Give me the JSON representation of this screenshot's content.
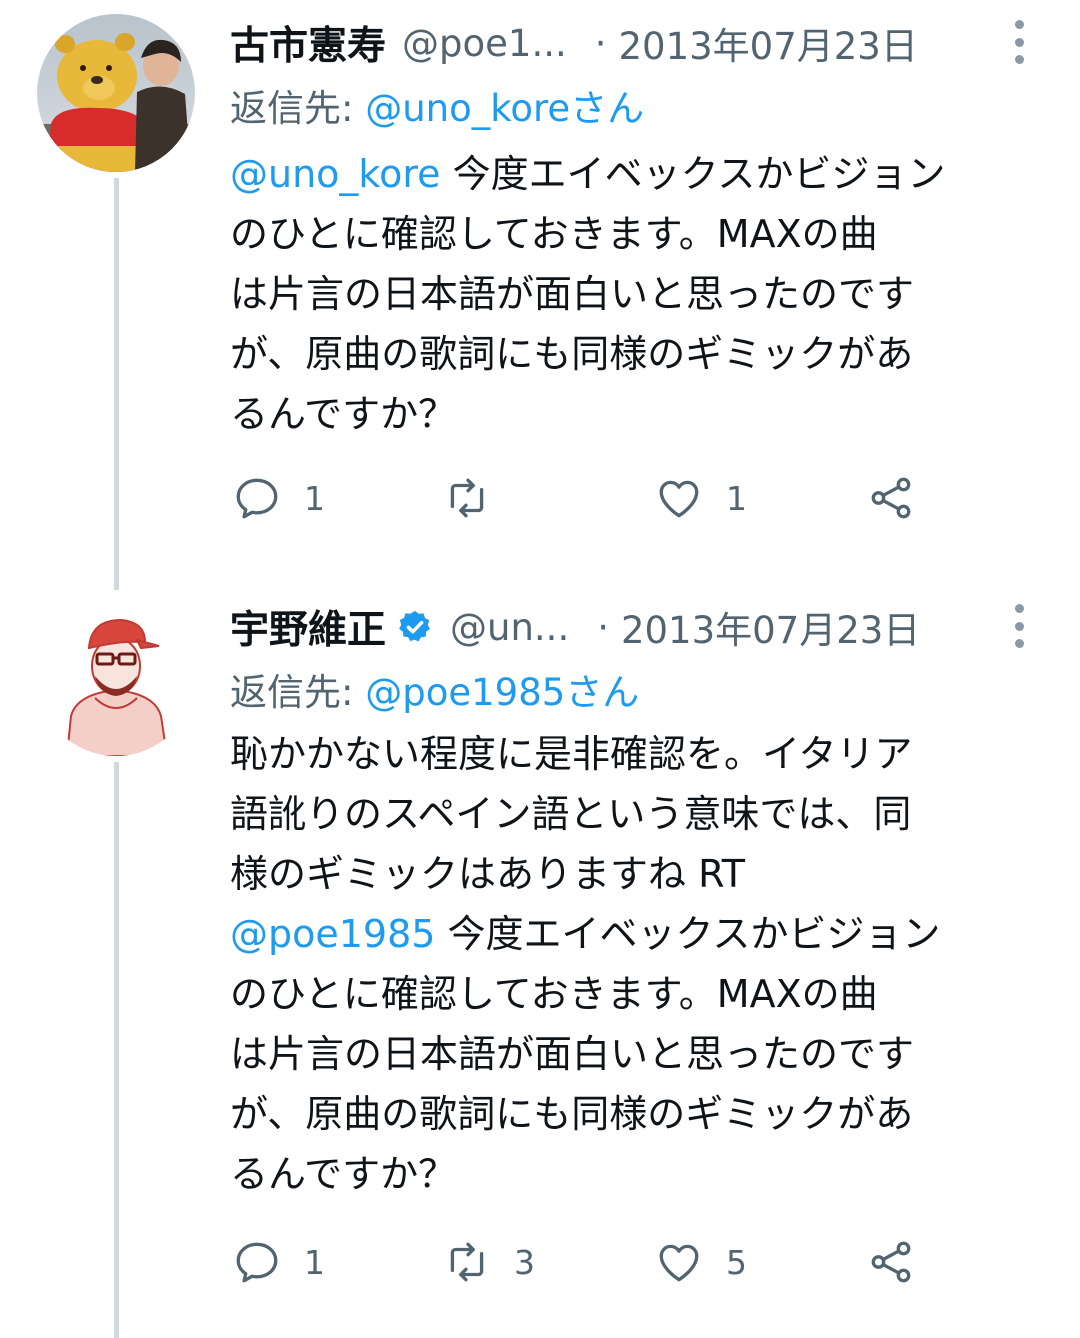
{
  "colors": {
    "accent": "#1d9bf0",
    "secondary_text": "#536471",
    "thread_line": "#cfd9de"
  },
  "tweets": [
    {
      "name": "古市憲寿",
      "handle": "@poe1...",
      "dot": "·",
      "date": "2013年07月23日",
      "reply_prefix": "返信先: ",
      "reply_to": "@uno_koreさん",
      "body": {
        "mention": "@uno_kore",
        "line1_rest": " 今度エイベックスかビジョン",
        "line2": "のひとに確認しておきます。MAXの曲",
        "line3": "は片言の日本語が面白いと思ったのです",
        "line4": "が、原曲の歌詞にも同様のギミックがあ",
        "line5": "るんですか？"
      },
      "actions": {
        "replies": "1",
        "retweets": "",
        "likes": "1"
      }
    },
    {
      "name": "宇野維正",
      "verified_icon": "verified-badge-icon",
      "handle": "@un...",
      "dot": "·",
      "date": "2013年07月23日",
      "reply_prefix": "返信先: ",
      "reply_to": "@poe1985さん",
      "body": {
        "line1": "恥かかない程度に是非確認を。イタリア",
        "line2": "語訛りのスペイン語という意味では、同",
        "line3": "様のギミックはありますね RT",
        "mention": "@poe1985",
        "line4_rest": " 今度エイベックスかビジョン",
        "line5": "のひとに確認しておきます。MAXの曲",
        "line6": "は片言の日本語が面白いと思ったのです",
        "line7": "が、原曲の歌詞にも同様のギミックがあ",
        "line8": "るんですか？"
      },
      "actions": {
        "replies": "1",
        "retweets": "3",
        "likes": "5"
      }
    }
  ]
}
